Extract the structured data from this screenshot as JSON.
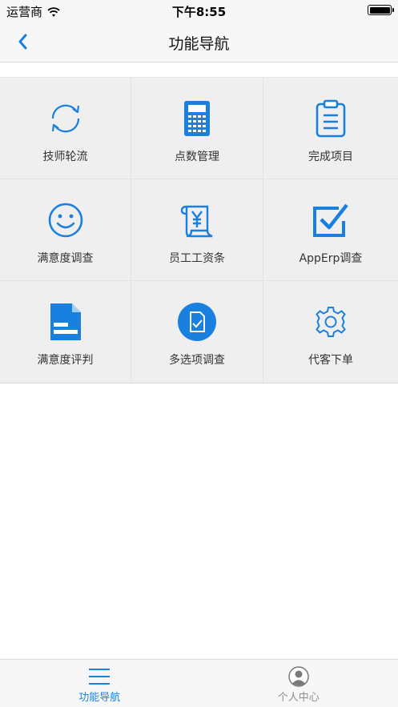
{
  "status_bar": {
    "carrier": "运营商",
    "time": "下午8:55",
    "battery_level": 1.0
  },
  "nav_bar": {
    "title": "功能导航",
    "back_icon": "chevron-left-icon"
  },
  "colors": {
    "accent": "#1a80e0",
    "grid_bg": "#efefef",
    "tab_inactive": "#8e8e8e"
  },
  "grid": {
    "items": [
      {
        "label": "技师轮流",
        "icon": "rotate-arrows-icon"
      },
      {
        "label": "点数管理",
        "icon": "calculator-icon"
      },
      {
        "label": "完成项目",
        "icon": "clipboard-icon"
      },
      {
        "label": "满意度调查",
        "icon": "smiley-face-icon"
      },
      {
        "label": "员工工资条",
        "icon": "salary-scroll-icon"
      },
      {
        "label": "AppErp调查",
        "icon": "checkbox-icon"
      },
      {
        "label": "满意度评判",
        "icon": "document-icon"
      },
      {
        "label": "多选项调查",
        "icon": "survey-badge-icon"
      },
      {
        "label": "代客下单",
        "icon": "gear-icon"
      }
    ]
  },
  "tab_bar": {
    "tabs": [
      {
        "label": "功能导航",
        "icon": "menu-lines-icon",
        "active": true
      },
      {
        "label": "个人中心",
        "icon": "user-avatar-icon",
        "active": false
      }
    ]
  }
}
